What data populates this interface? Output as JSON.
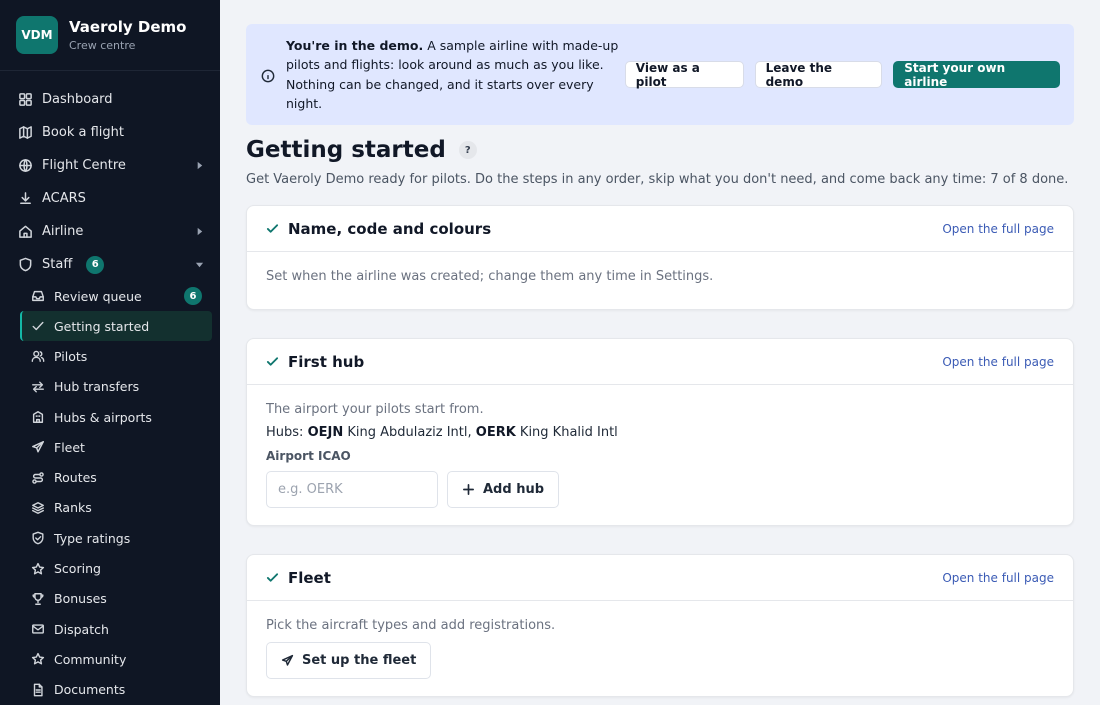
{
  "brand": {
    "logo": "VDM",
    "name": "Vaeroly Demo",
    "subtitle": "Crew centre"
  },
  "nav": [
    {
      "label": "Dashboard",
      "icon": "grid-icon"
    },
    {
      "label": "Book a flight",
      "icon": "map-icon"
    },
    {
      "label": "Flight Centre",
      "icon": "globe-icon",
      "caret": "right"
    },
    {
      "label": "ACARS",
      "icon": "download-icon"
    },
    {
      "label": "Airline",
      "icon": "home-icon",
      "caret": "right"
    },
    {
      "label": "Staff",
      "icon": "shield-icon",
      "caret": "down",
      "badge": "6"
    }
  ],
  "staff_items": [
    {
      "label": "Review queue",
      "icon": "inbox-icon",
      "badge": "6"
    },
    {
      "label": "Getting started",
      "icon": "check-icon",
      "active": true
    },
    {
      "label": "Pilots",
      "icon": "users-icon"
    },
    {
      "label": "Hub transfers",
      "icon": "transfer-icon"
    },
    {
      "label": "Hubs & airports",
      "icon": "building-icon"
    },
    {
      "label": "Fleet",
      "icon": "plane-icon"
    },
    {
      "label": "Routes",
      "icon": "route-icon"
    },
    {
      "label": "Ranks",
      "icon": "layers-icon"
    },
    {
      "label": "Type ratings",
      "icon": "shield-check-icon"
    },
    {
      "label": "Scoring",
      "icon": "star-icon"
    },
    {
      "label": "Bonuses",
      "icon": "trophy-icon"
    },
    {
      "label": "Dispatch",
      "icon": "mail-icon"
    },
    {
      "label": "Community",
      "icon": "star-icon"
    },
    {
      "label": "Documents",
      "icon": "document-icon"
    }
  ],
  "banner": {
    "bold": "You're in the demo.",
    "text": " A sample airline with made-up pilots and flights: look around as much as you like. Nothing can be changed, and it starts over every night.",
    "btn_pilot": "View as a pilot",
    "btn_leave": "Leave the demo",
    "btn_start": "Start your own airline"
  },
  "page": {
    "title": "Getting started",
    "help": "?",
    "subtitle": "Get Vaeroly Demo ready for pilots. Do the steps in any order, skip what you don't need, and come back any time: 7 of 8 done."
  },
  "cards": {
    "name": {
      "title": "Name, code and colours",
      "link": "Open the full page",
      "body": "Set when the airline was created; change them any time in Settings."
    },
    "hub": {
      "title": "First hub",
      "link": "Open the full page",
      "body": "The airport your pilots start from.",
      "hubs_prefix": "Hubs: ",
      "hub1_code": "OEJN",
      "hub1_name": " King Abdulaziz Intl, ",
      "hub2_code": "OERK",
      "hub2_name": " King Khalid Intl",
      "field_label": "Airport ICAO",
      "placeholder": "e.g. OERK",
      "add_label": "Add hub"
    },
    "fleet": {
      "title": "Fleet",
      "link": "Open the full page",
      "body": "Pick the aircraft types and add registrations.",
      "button": "Set up the fleet"
    }
  },
  "colors": {
    "sidebar_bg": "#0f1624",
    "accent": "#0f766e",
    "banner_bg": "#e0e7ff",
    "link": "#3b5bb5"
  }
}
